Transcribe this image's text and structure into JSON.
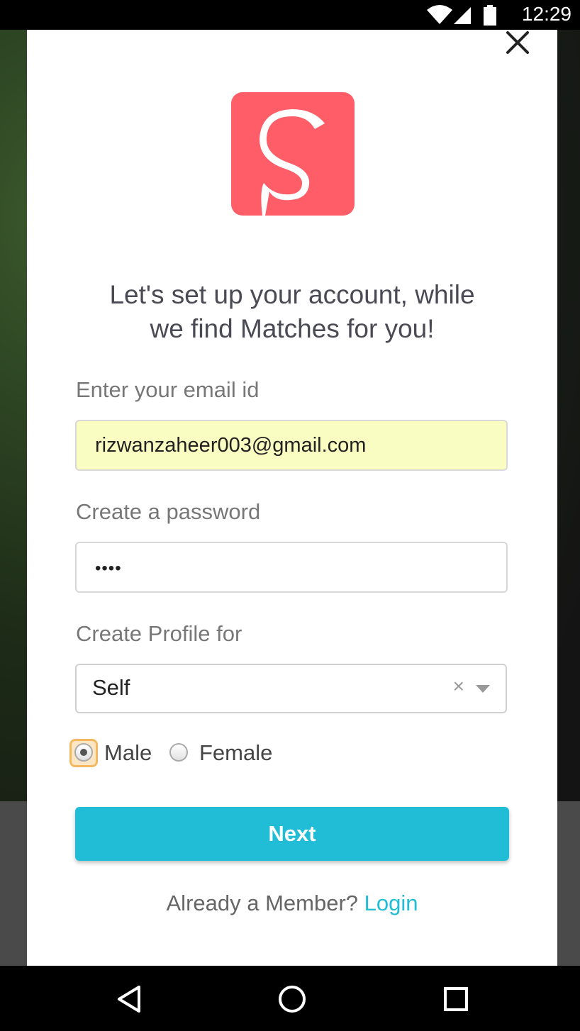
{
  "status_bar": {
    "time": "12:29",
    "icons": [
      "wifi-icon",
      "cell-signal-icon",
      "battery-icon"
    ]
  },
  "modal": {
    "close_icon": "close-icon",
    "logo_letter": "S",
    "heading_line1": "Let's set up your account, while",
    "heading_line2": "we find Matches for you!",
    "email": {
      "label": "Enter your email id",
      "value": "rizwanzaheer003@gmail.com"
    },
    "password": {
      "label": "Create a password",
      "value": "••••"
    },
    "profile": {
      "label": "Create Profile for",
      "selected": "Self",
      "clear_glyph": "×"
    },
    "gender": {
      "options": [
        {
          "label": "Male",
          "checked": true
        },
        {
          "label": "Female",
          "checked": false
        }
      ]
    },
    "next_label": "Next",
    "member_prompt": "Already a Member?",
    "login_label": "Login"
  },
  "nav_bar": {
    "icons": [
      "back-icon",
      "home-icon",
      "recents-icon"
    ]
  },
  "colors": {
    "brand": "#ff5d68",
    "accent": "#21bcd6",
    "autofill": "#fafdc2"
  }
}
